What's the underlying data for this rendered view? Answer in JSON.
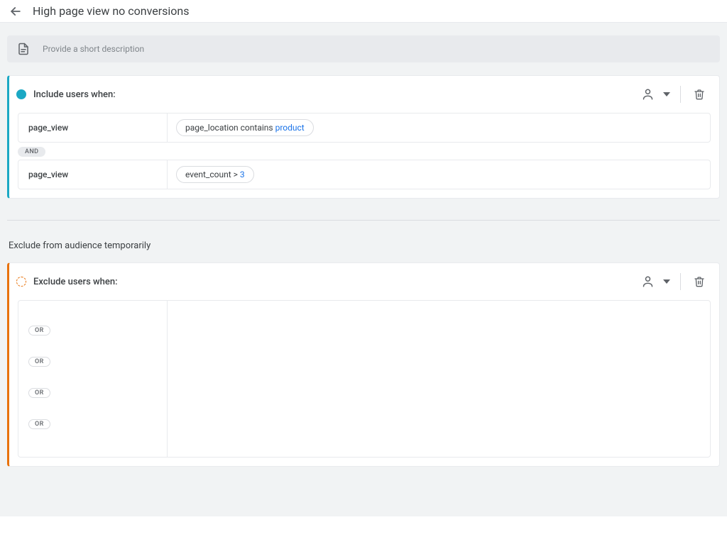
{
  "header": {
    "title": "High page view no conversions"
  },
  "description": {
    "placeholder": "Provide a short description"
  },
  "include": {
    "title": "Include users when:",
    "connector": "AND",
    "conditions": [
      {
        "event": "page_view",
        "chip_prefix": "page_location contains",
        "chip_value": "product"
      },
      {
        "event": "page_view",
        "chip_prefix": "event_count >",
        "chip_value": "3"
      }
    ]
  },
  "excludeHeading": "Exclude from audience temporarily",
  "exclude": {
    "title": "Exclude users when:",
    "or_label": "OR",
    "row_count": 5
  }
}
